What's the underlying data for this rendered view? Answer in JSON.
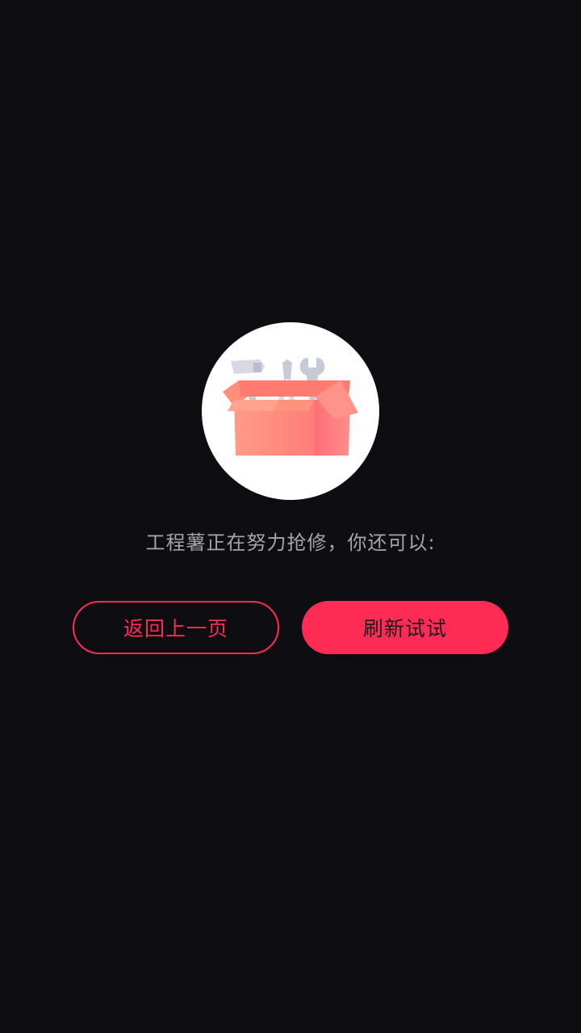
{
  "error_page": {
    "illustration_icon": "toolbox-icon",
    "message": "工程薯正在努力抢修，你还可以:",
    "back_button_label": "返回上一页",
    "refresh_button_label": "刷新试试"
  },
  "colors": {
    "background": "#0e0d12",
    "accent": "#fe2c55",
    "message_text": "#a4a4ab",
    "circle": "#ffffff",
    "box": "#ff8a7a"
  }
}
